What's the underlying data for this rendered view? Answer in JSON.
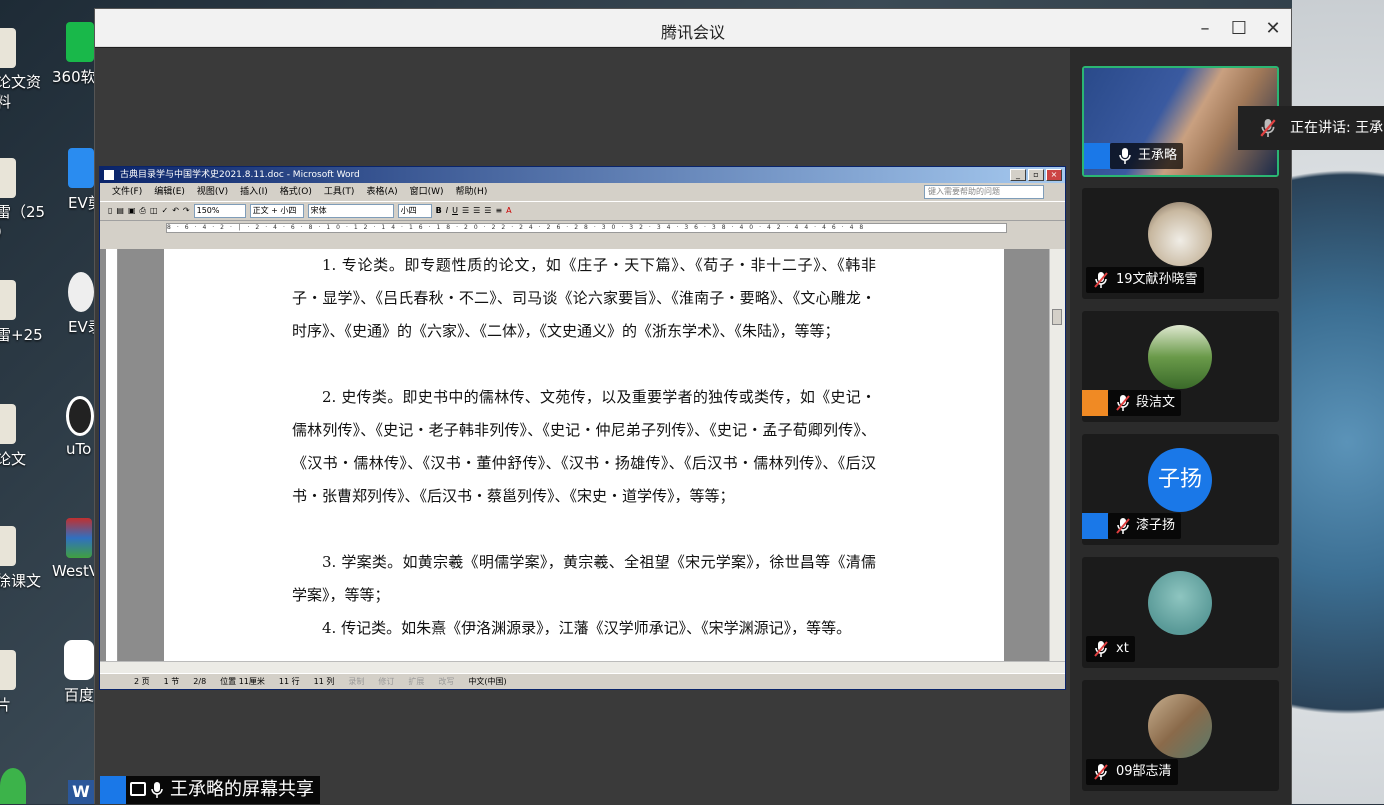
{
  "desktop": {
    "icons": [
      {
        "label": "论文资\n料",
        "x": "left"
      },
      {
        "label": "360软",
        "x": "col2"
      },
      {
        "label": "雷（25\n）",
        "x": "left"
      },
      {
        "label": "EV剪",
        "x": "col2"
      },
      {
        "label": "雷+25",
        "x": "left"
      },
      {
        "label": "EV录",
        "x": "col2"
      },
      {
        "label": "论文",
        "x": "left"
      },
      {
        "label": "uTo",
        "x": "col2"
      },
      {
        "label": "徐课文",
        "x": "left"
      },
      {
        "label": "WestV",
        "x": "col2"
      },
      {
        "label": "片",
        "x": "left"
      },
      {
        "label": "百度",
        "x": "col2"
      }
    ]
  },
  "window": {
    "title": "腾讯会议",
    "minimize_icon": "–",
    "maximize_icon": "☐",
    "close_icon": "✕"
  },
  "speaking": "正在讲话: 王承",
  "participants": [
    {
      "name": "王承略",
      "mic": "on",
      "has_user_badge": true,
      "active": true,
      "avatar": "video"
    },
    {
      "name": "19文献孙晓雪",
      "mic": "muted",
      "has_user_badge": false,
      "avatar": "dog"
    },
    {
      "name": "段洁文",
      "mic": "muted",
      "has_user_badge": true,
      "badge_color": "#f08a24",
      "avatar": "garden"
    },
    {
      "name": "漆子扬",
      "mic": "muted",
      "has_user_badge": true,
      "avatar": "text",
      "avatar_text": "子扬",
      "avatar_color": "#1a78e8"
    },
    {
      "name": "xt",
      "mic": "muted",
      "has_user_badge": false,
      "avatar": "blossom"
    },
    {
      "name": "09郜志清",
      "mic": "muted",
      "has_user_badge": false,
      "avatar": "street"
    }
  ],
  "share_label": "王承略的屏幕共享",
  "word": {
    "title": "古典目录学与中国学术史2021.8.11.doc - Microsoft Word",
    "menu": [
      "文件(F)",
      "编辑(E)",
      "视图(V)",
      "插入(I)",
      "格式(O)",
      "工具(T)",
      "表格(A)",
      "窗口(W)",
      "帮助(H)"
    ],
    "help_placeholder": "键入需要帮助的问题",
    "zoom": "150%",
    "style": "正文 + 小四",
    "font": "宋体",
    "size": "小四",
    "paragraphs": [
      "1. 专论类。即专题性质的论文，如《庄子・天下篇》、《荀子・非十二子》、《韩非子・显学》、《吕氏春秋・不二》、司马谈《论六家要旨》、《淮南子・要略》、《文心雕龙・时序》、《史通》的《六家》、《二体》，《文史通义》的《浙东学术》、《朱陆》，等等；",
      "2. 史传类。即史书中的儒林传、文苑传，以及重要学者的独传或类传，如《史记・儒林列传》、《史记・老子韩非列传》、《史记・仲尼弟子列传》、《史记・孟子荀卿列传》、《汉书・儒林传》、《汉书・董仲舒传》、《汉书・扬雄传》、《后汉书・儒林列传》、《后汉书・张曹郑列传》、《后汉书・蔡邕列传》、《宋史・道学传》，等等；",
      "3. 学案类。如黄宗羲《明儒学案》，黄宗羲、全祖望《宋元学案》，徐世昌等《清儒学案》，等等；",
      "4. 传记类。如朱熹《伊洛渊源录》，江藩《汉学师承记》、《宋学渊源记》，等等。"
    ],
    "status": {
      "page": "2 页",
      "section": "1 节",
      "pages": "2/8",
      "position": "位置 11厘米",
      "line": "11 行",
      "col": "11 列",
      "rec": "录制",
      "trk": "修订",
      "ext": "扩展",
      "ovr": "改写",
      "lang": "中文(中国)"
    }
  },
  "colors": {
    "accent": "#1a78e8",
    "active_border": "#2bb673",
    "muted_mic": "#e04040"
  }
}
